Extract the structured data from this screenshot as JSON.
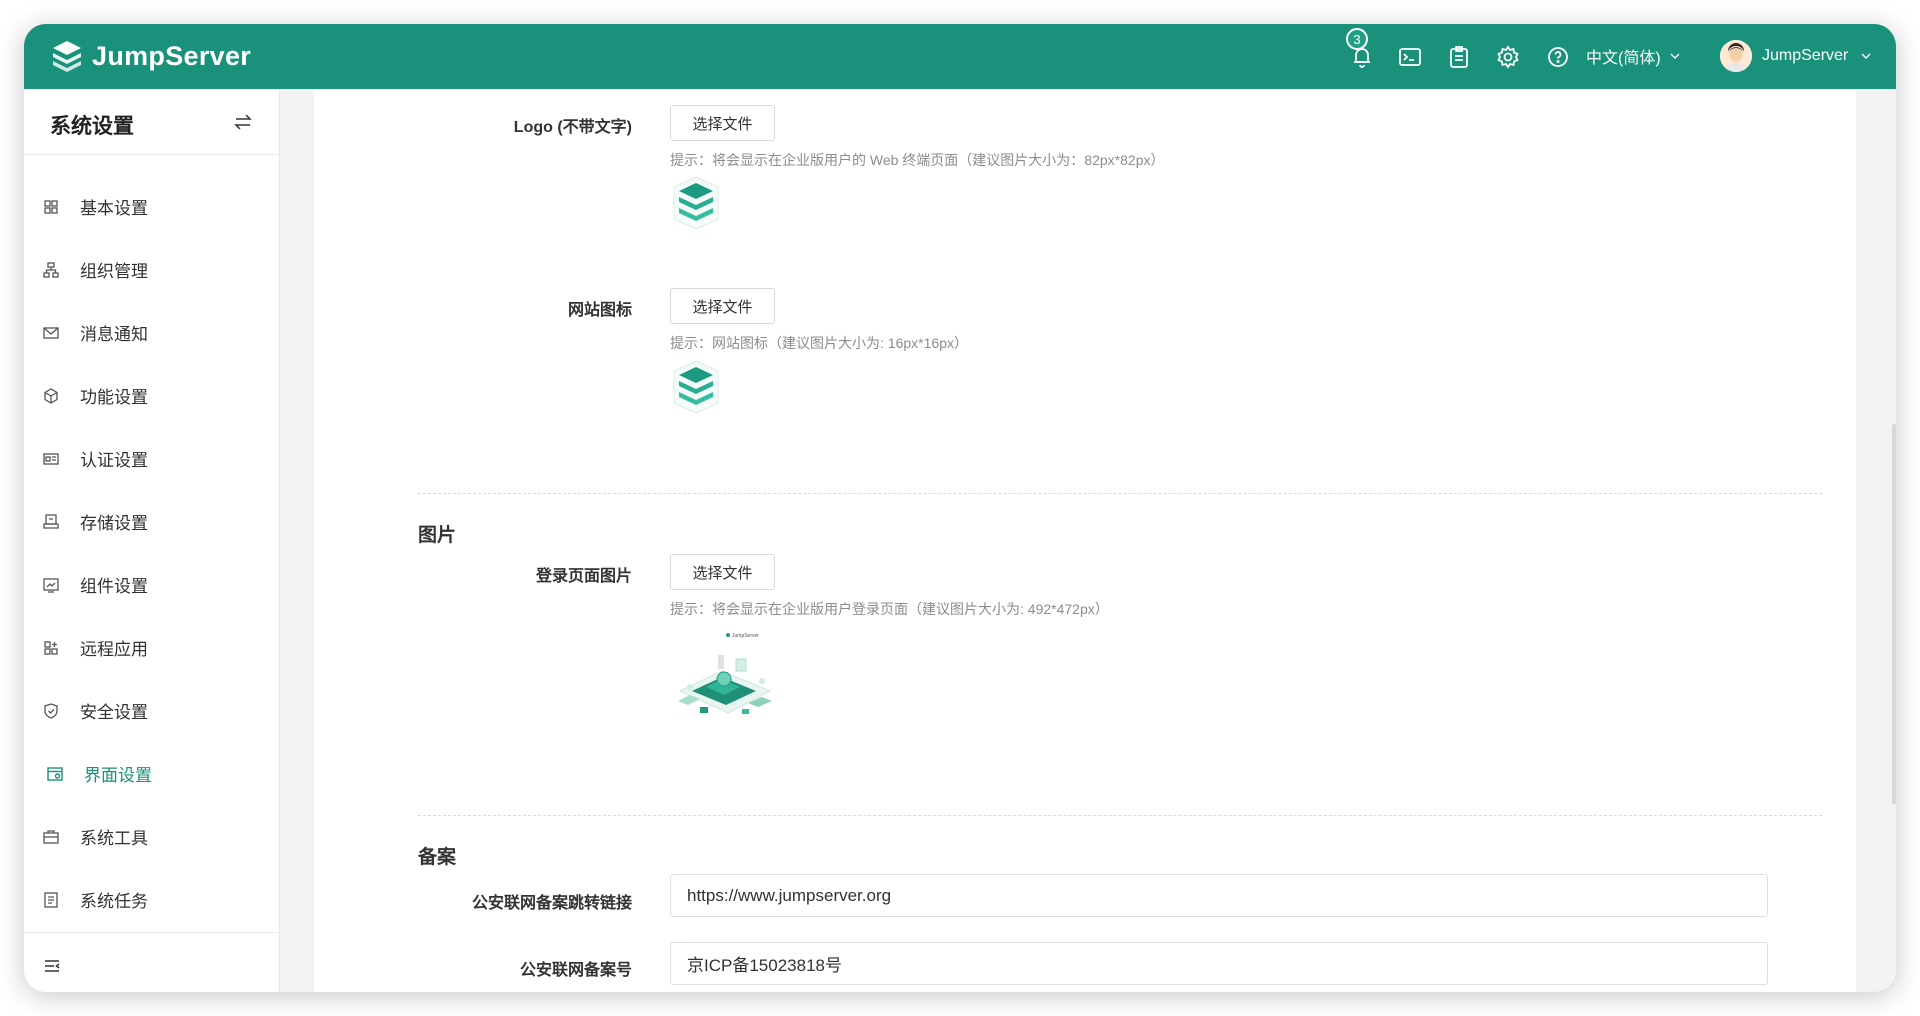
{
  "app": {
    "brand": "JumpServer",
    "accent": "#1a917a"
  },
  "topbar": {
    "notification_count": "3",
    "language": "中文(简体)",
    "username": "JumpServer",
    "icons": [
      "bell-icon",
      "terminal-icon",
      "clipboard-icon",
      "gear-icon",
      "help-icon"
    ]
  },
  "sidebar": {
    "title": "系统设置",
    "items": [
      {
        "label": "基本设置",
        "icon": "grid-icon"
      },
      {
        "label": "组织管理",
        "icon": "org-icon"
      },
      {
        "label": "消息通知",
        "icon": "mail-icon"
      },
      {
        "label": "功能设置",
        "icon": "cube-icon"
      },
      {
        "label": "认证设置",
        "icon": "id-card-icon"
      },
      {
        "label": "存储设置",
        "icon": "storage-icon"
      },
      {
        "label": "组件设置",
        "icon": "component-icon"
      },
      {
        "label": "远程应用",
        "icon": "apps-icon"
      },
      {
        "label": "安全设置",
        "icon": "shield-icon"
      },
      {
        "label": "界面设置",
        "icon": "interface-icon",
        "active": true
      },
      {
        "label": "系统工具",
        "icon": "toolbox-icon"
      },
      {
        "label": "系统任务",
        "icon": "task-icon"
      }
    ]
  },
  "form": {
    "logo_text_less": {
      "label": "Logo (不带文字)",
      "button": "选择文件",
      "hint": "提示：将会显示在企业版用户的 Web 终端页面（建议图片大小为：82px*82px）"
    },
    "favicon": {
      "label": "网站图标",
      "button": "选择文件",
      "hint": "提示：网站图标（建议图片大小为: 16px*16px）"
    },
    "images_section": {
      "title": "图片"
    },
    "login_image": {
      "label": "登录页面图片",
      "button": "选择文件",
      "hint": "提示：将会显示在企业版用户登录页面（建议图片大小为: 492*472px）",
      "preview_caption": "JumpServer"
    },
    "beian_section": {
      "title": "备案"
    },
    "beian_link": {
      "label": "公安联网备案跳转链接",
      "value": "https://www.jumpserver.org"
    },
    "beian_number": {
      "label": "公安联网备案号",
      "value": "京ICP备15023818号"
    }
  }
}
